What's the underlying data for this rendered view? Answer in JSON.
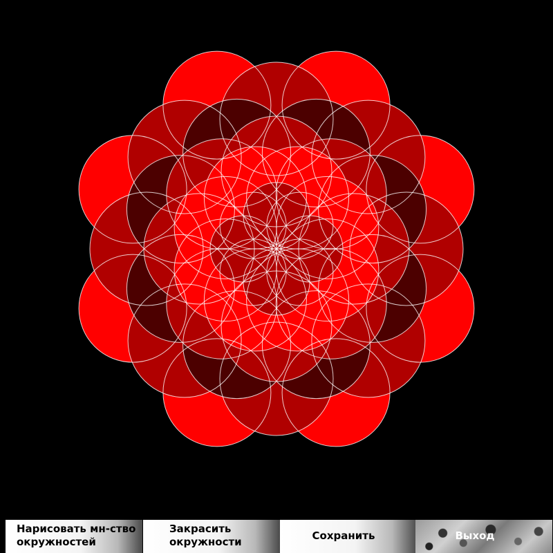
{
  "canvas": {
    "background": "#000000",
    "circle_stroke": "#ffffff",
    "palette": [
      "#ff0000",
      "#b00000",
      "#4c0000"
    ]
  },
  "toolbar": {
    "draw_set_label_line1": "Нарисовать мн-ство",
    "draw_set_label_line2": "окружностей",
    "fill_label_line1": "Закрасить",
    "fill_label_line2": "окружности",
    "save_label": "Сохранить",
    "exit_label": "Выход"
  }
}
